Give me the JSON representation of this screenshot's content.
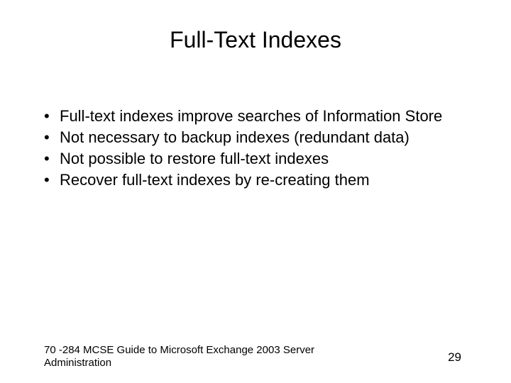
{
  "title": "Full-Text Indexes",
  "bullets": [
    "Full-text indexes improve searches of Information Store",
    "Not necessary to backup indexes (redundant data)",
    "Not possible to restore full-text indexes",
    "Recover full-text indexes by re-creating them"
  ],
  "footer": "70 -284 MCSE Guide to Microsoft Exchange 2003 Server Administration",
  "page_number": "29"
}
